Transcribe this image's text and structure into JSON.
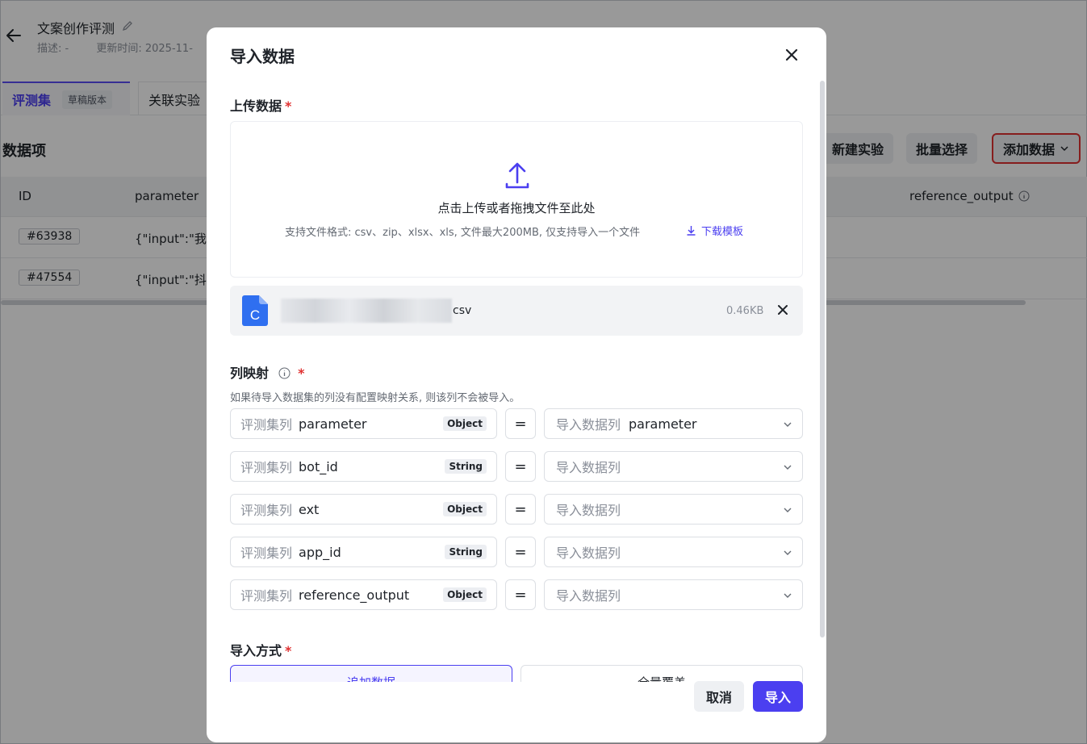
{
  "page": {
    "title": "文案创作评测",
    "desc_label": "描述: -",
    "updated_label": "更新时间: 2025-11-",
    "tabs": [
      {
        "label": "评测集",
        "badge": "草稿版本"
      },
      {
        "label": "关联实验"
      }
    ],
    "section_title": "数据项",
    "buttons": {
      "new_experiment": "新建实验",
      "batch_select": "批量选择",
      "add_data": "添加数据"
    },
    "table": {
      "headers": {
        "id": "ID",
        "parameter": "parameter",
        "reference_output": "reference_output"
      },
      "rows": [
        {
          "id": "#63938",
          "parameter": "{\"input\":\"我"
        },
        {
          "id": "#47554",
          "parameter": "{\"input\":\"抖"
        }
      ]
    }
  },
  "modal": {
    "title": "导入数据",
    "upload": {
      "label": "上传数据",
      "required_mark": "*",
      "main_text": "点击上传或者拖拽文件至此处",
      "hint": "支持文件格式: csv、zip、xlsx、xls, 文件最大200MB, 仅支持导入一个文件",
      "download_template": "下载模板"
    },
    "file": {
      "icon_letter": "C",
      "ext": "csv",
      "size": "0.46KB"
    },
    "mapping": {
      "label": "列映射",
      "required_mark": "*",
      "hint": "如果待导入数据集的列没有配置映射关系, 则该列不会被导入。",
      "source_prefix": "评测集列",
      "target_placeholder": "导入数据列",
      "equals": "=",
      "rows": [
        {
          "source": "parameter",
          "type": "Object",
          "target": "parameter"
        },
        {
          "source": "bot_id",
          "type": "String",
          "target": ""
        },
        {
          "source": "ext",
          "type": "Object",
          "target": ""
        },
        {
          "source": "app_id",
          "type": "String",
          "target": ""
        },
        {
          "source": "reference_output",
          "type": "Object",
          "target": ""
        }
      ]
    },
    "import_mode": {
      "label": "导入方式",
      "required_mark": "*",
      "options": [
        "追加数据",
        "全量覆盖"
      ],
      "selected": "追加数据"
    },
    "footer": {
      "cancel": "取消",
      "import": "导入"
    }
  },
  "colors": {
    "accent": "#4b3ff0",
    "required": "#e03131",
    "file_icon": "#2f6ff0"
  }
}
